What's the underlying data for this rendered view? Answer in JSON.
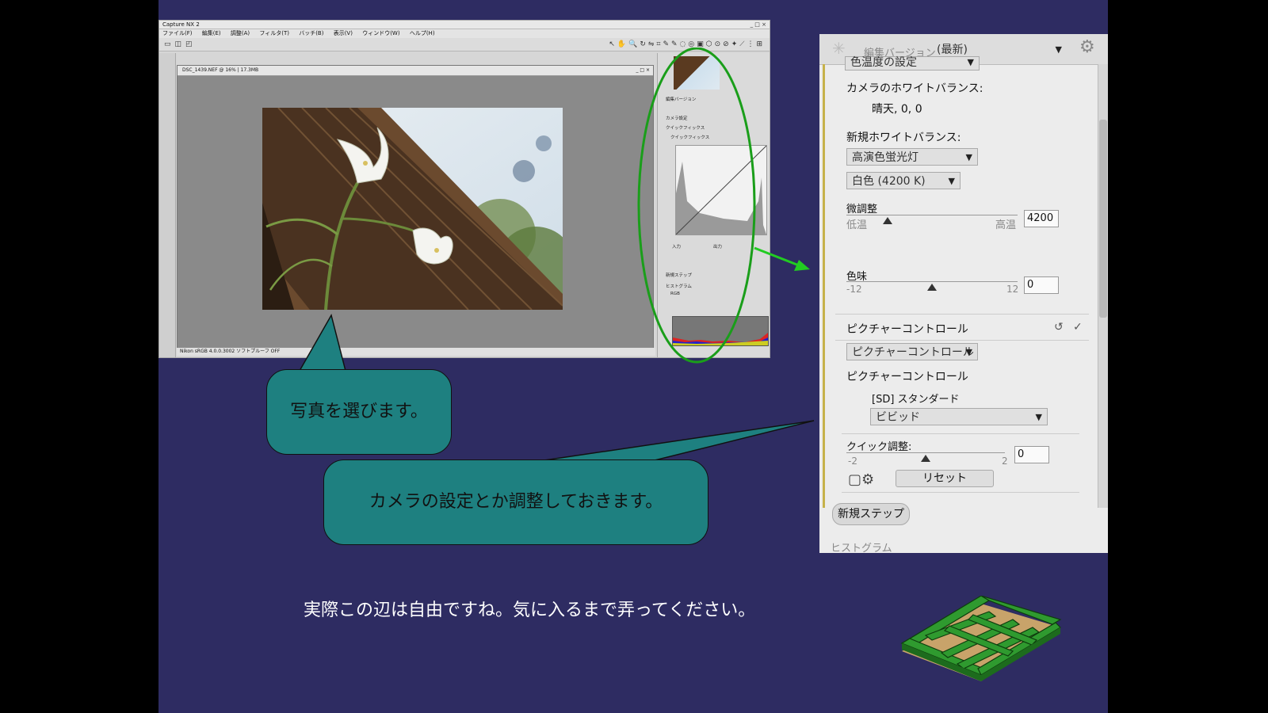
{
  "app": {
    "title": "Capture NX 2",
    "window_controls": "_ □ ×",
    "menu": [
      "ファイル(F)",
      "編集(E)",
      "調整(A)",
      "フィルタ(T)",
      "バッチ(B)",
      "表示(V)",
      "ウィンドウ(W)",
      "ヘルプ(H)"
    ],
    "document_title": "DSC_1439.NEF @ 16% | 17.3MB",
    "status": "Nikon sRGB 4.0.0.3002    ソフトプルーフ OFF",
    "panel_labels": {
      "edit_version": "編集バージョン",
      "camera_settings": "カメラ設定",
      "quick_fix": "クイックフィックス",
      "quick_fix_sub": "クイックフィックス",
      "input": "入力",
      "output": "出力",
      "new_step": "新規ステップ",
      "histogram": "ヒストグラム",
      "channel": "RGB"
    }
  },
  "callouts": {
    "select_photo": "写真を選びます。",
    "adjust_camera": "カメラの設定とか調整しておきます。"
  },
  "caption": "実際この辺は自由ですね。気に入るまで弄ってください。",
  "panel": {
    "edit_version_label": "編集バージョン",
    "edit_version_value": "(最新)",
    "color_temp_setting": "色温度の設定",
    "camera_wb_label": "カメラのホワイトバランス:",
    "camera_wb_value": "晴天, 0, 0",
    "new_wb_label": "新規ホワイトバランス:",
    "new_wb_value": "高演色蛍光灯",
    "white_value": "白色 (4200 K)",
    "fine_tune_label": "微調整",
    "low_temp": "低温",
    "high_temp": "高温",
    "fine_tune_value": "4200",
    "fine_tune_level": 0.24,
    "tint_label": "色味",
    "tint_min": "-12",
    "tint_max": "12",
    "tint_value": "0",
    "picture_control_header": "ピクチャーコントロール",
    "picture_control_dropdown": "ピクチャーコントロール",
    "picture_control_label": "ピクチャーコントロール",
    "picture_control_current": "[SD] スタンダード",
    "picture_control_select": "ビビッド",
    "quick_adjust_label": "クイック調整:",
    "quick_adjust_min": "-2",
    "quick_adjust_max": "2",
    "quick_adjust_value": "0",
    "reset_button": "リセット",
    "new_step_button": "新規ステップ",
    "histogram_label": "ヒストグラム"
  },
  "colors": {
    "slide_background": "#2e2c62",
    "callout_fill": "#1e8080",
    "highlight_ellipse": "#1a9e1a",
    "arrow": "#22cc22",
    "panel_accent": "#c6b24a"
  }
}
